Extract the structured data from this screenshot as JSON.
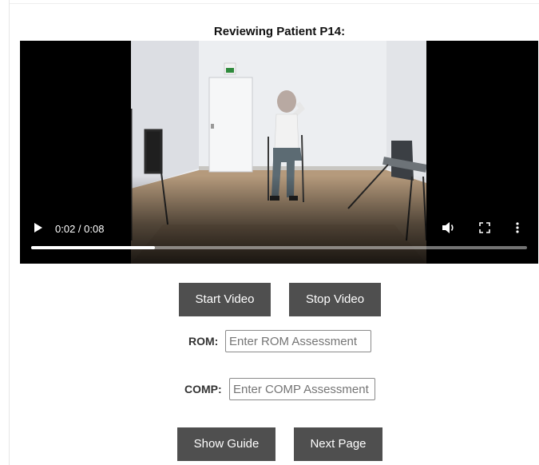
{
  "page": {
    "title": "Reviewing Patient P14:"
  },
  "video": {
    "time_display": "0:02 / 0:08",
    "progress_fraction": 0.25,
    "controls": {
      "play": "play-icon",
      "volume": "volume-icon",
      "fullscreen": "fullscreen-icon",
      "more": "more-vertical-icon"
    }
  },
  "buttons": {
    "start_video": "Start Video",
    "stop_video": "Stop Video",
    "show_guide": "Show Guide",
    "next_page": "Next Page"
  },
  "fields": {
    "rom": {
      "label": "ROM:",
      "value": "",
      "placeholder": "Enter ROM Assessment"
    },
    "comp": {
      "label": "COMP:",
      "value": "",
      "placeholder": "Enter COMP Assessment"
    }
  },
  "colors": {
    "button_bg": "#4f4f4f",
    "button_text": "#ffffff",
    "video_bg": "#000000"
  }
}
